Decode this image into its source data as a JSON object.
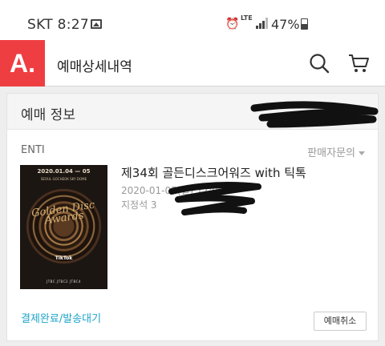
{
  "status_bar": {
    "carrier": "SKT",
    "time": "8:27",
    "network": "LTE",
    "battery": "47%",
    "battery_level": 0.47,
    "icons": [
      "gallery-icon",
      "alarm-icon",
      "lte-icon",
      "signal-icon",
      "battery-icon"
    ]
  },
  "header": {
    "logo": "A.",
    "title": "예매상세내역",
    "icons": [
      "search-icon",
      "cart-icon"
    ],
    "accent_color": "#ef3e42"
  },
  "card": {
    "title": "예매 정보",
    "genre": "ENTI",
    "seller_label": "판매자문의",
    "poster": {
      "date": "2020.01.04 — 05",
      "venue": "SEOUL GOCHEOK SKY DOME",
      "logo_text": "Golden Disc Awards",
      "sponsor": "TikTok",
      "footer": "JTBC  JTBC2  JTBC4"
    },
    "event_name": "제34회 골든디스크어워즈 with 틱톡",
    "event_datetime": "2020-01-05(일) 17:00",
    "seat": "지정석 3",
    "payment_status": "결제완료/발송대기",
    "cancel_label": "예매취소",
    "link_color": "#1ea3c9"
  }
}
